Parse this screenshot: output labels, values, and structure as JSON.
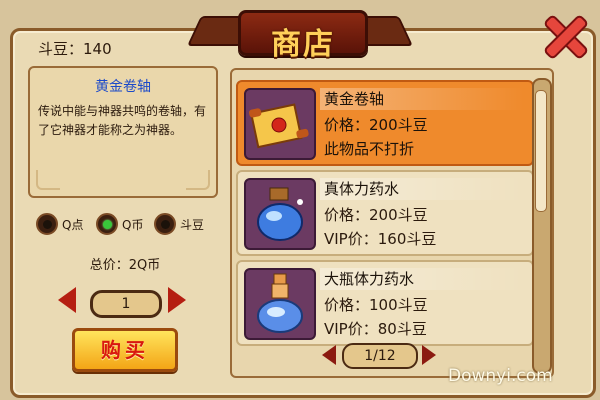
{
  "window": {
    "title": "商店"
  },
  "header": {
    "beans_label": "斗豆：140"
  },
  "detail": {
    "item_name": "黄金卷轴",
    "description": "传说中能与神器共鸣的卷轴，有了它神器才能称之为神器。"
  },
  "payment": {
    "options": [
      {
        "label": "Q点",
        "selected": false
      },
      {
        "label": "Q币",
        "selected": true
      },
      {
        "label": "斗豆",
        "selected": false
      }
    ],
    "total_label": "总价：2Q币",
    "quantity": "1",
    "buy_label": "购买"
  },
  "items": [
    {
      "name": "黄金卷轴",
      "line1": "价格：200斗豆",
      "line2": "此物品不打折",
      "selected": true,
      "icon": "scroll-icon"
    },
    {
      "name": "真体力药水",
      "line1": "价格：200斗豆",
      "line2": "VIP价：160斗豆",
      "selected": false,
      "icon": "potion-icon"
    },
    {
      "name": "大瓶体力药水",
      "line1": "价格：100斗豆",
      "line2": "VIP价：80斗豆",
      "selected": false,
      "icon": "large-potion-icon"
    }
  ],
  "pager": {
    "label": "1/12"
  },
  "watermark": "Downyi.com",
  "colors": {
    "accent": "#ef8a2c",
    "title": "#ffd05a",
    "link": "#1b49c9",
    "buy_text": "#d9180f"
  }
}
